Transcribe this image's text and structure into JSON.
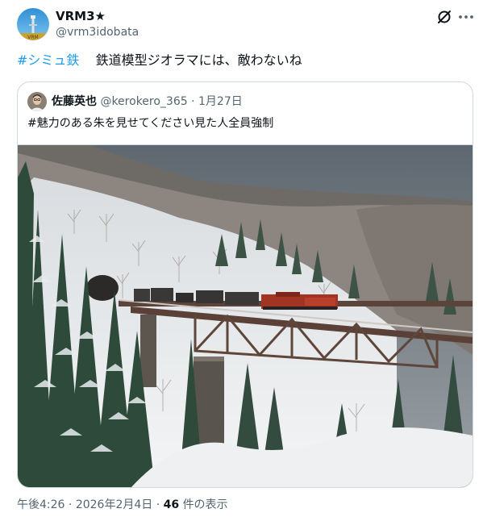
{
  "author": {
    "name": "VRM3★",
    "handle": "@vrm3idobata",
    "avatar_icon": "tower-logo-icon"
  },
  "post": {
    "hashtag": "#シミュ鉄",
    "text": "鉄道模型ジオラマには、敵わないね"
  },
  "quote": {
    "author_name": "佐藤英也",
    "author_handle": "@kerokero_365",
    "separator": "·",
    "date": "1月27日",
    "text": "#魅力のある朱を見せてください見た人全員強制",
    "image_description_icon": "snowy-railway-diorama-photo"
  },
  "footer": {
    "time": "午後4:26",
    "separator": "·",
    "date": "2026年2月4日",
    "views_count": "46",
    "views_label": "件の表示"
  },
  "colors": {
    "accent": "#1d9bf0",
    "secondary_text": "#536471",
    "border": "#cfd9de"
  }
}
